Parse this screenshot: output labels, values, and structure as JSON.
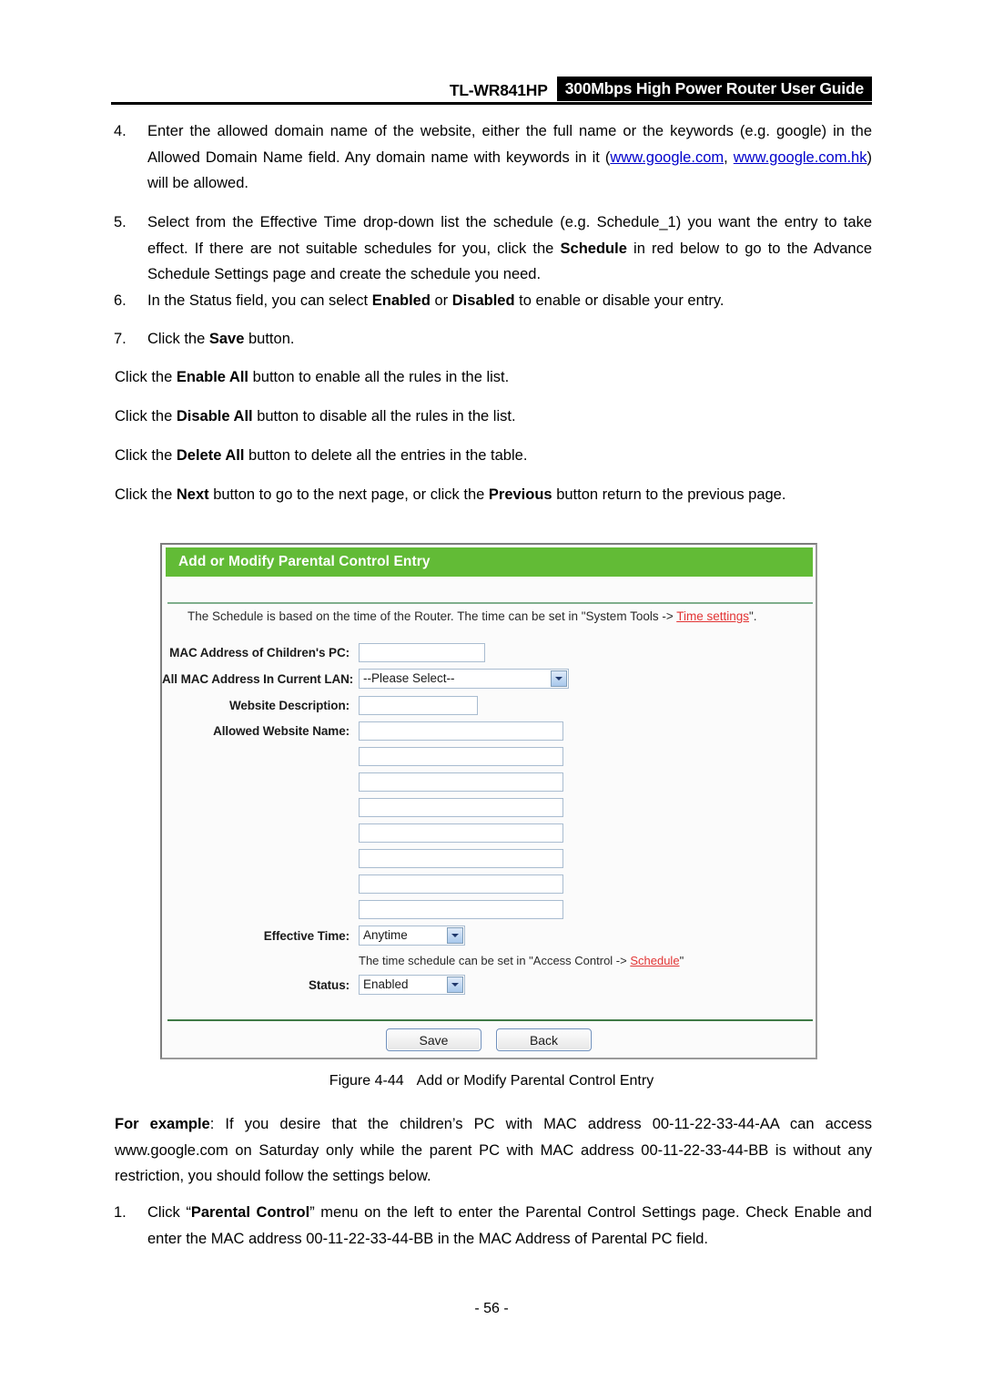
{
  "header": {
    "model": "TL-WR841HP",
    "title": "300Mbps High Power Router User Guide"
  },
  "steps": [
    {
      "num": "4.",
      "text_before": "Enter the allowed domain name of the website, either the full name or the keywords (e.g. google) in the Allowed Domain Name field. Any domain name with keywords in it (",
      "link1": "www.google.com",
      "mid": ", ",
      "link2": "www.google.com.hk",
      "text_after": ") will be allowed."
    },
    {
      "num": "5.",
      "part1": "Select from the Effective Time drop-down list the schedule (e.g. Schedule_1) you want the entry to take effect. If there are not suitable schedules for you, click the ",
      "bold1": "Schedule",
      "part2": " in red below to go to the Advance Schedule Settings page and create the schedule you need."
    },
    {
      "num": "6.",
      "part1": "In the Status field, you can select ",
      "bold1": "Enabled",
      "part2": " or ",
      "bold2": "Disabled",
      "part3": " to enable or disable your entry."
    },
    {
      "num": "7.",
      "part1": "Click the ",
      "bold1": "Save",
      "part2": " button."
    }
  ],
  "paragraphs": [
    {
      "part1": "Click the ",
      "bold1": "Enable All",
      "part2": " button to enable all the rules in the list."
    },
    {
      "part1": "Click the ",
      "bold1": "Disable All",
      "part2": " button to disable all the rules in the list."
    },
    {
      "part1": "Click the ",
      "bold1": "Delete All",
      "part2": " button to delete all the entries in the table."
    },
    {
      "part1": "Click the ",
      "bold1": "Next",
      "part2": " button to go to the next page, or click the ",
      "bold2": "Previous",
      "part3": " button return to the previous page."
    }
  ],
  "panel": {
    "title": "Add or Modify Parental Control Entry",
    "note_before": "The Schedule is based on the time of the Router. The time can be set in \"System Tools -> ",
    "note_link": "Time settings",
    "note_after": "\".",
    "fields": {
      "mac_label": "MAC Address of Children's PC:",
      "mac_value": "",
      "lan_label": "All MAC Address In Current LAN:",
      "lan_value": "--Please Select--",
      "desc_label": "Website Description:",
      "desc_value": "",
      "website_label": "Allowed Website Name:",
      "website_values": [
        "",
        "",
        "",
        "",
        "",
        "",
        "",
        ""
      ],
      "time_label": "Effective Time:",
      "time_value": "Anytime",
      "time_note_before": "The time schedule can be set in \"Access Control -> ",
      "time_note_link": "Schedule",
      "time_note_after": "\"",
      "status_label": "Status:",
      "status_value": "Enabled"
    },
    "buttons": {
      "save": "Save",
      "back": "Back"
    },
    "colors": {
      "header_green": "#62bb36",
      "link_red": "#e23434",
      "rule_green": "#3f7a46"
    }
  },
  "figure": {
    "number": "Figure 4-44",
    "caption": "Add or Modify Parental Control Entry"
  },
  "example": {
    "label": "For example",
    "text": ": If you desire that the children’s PC with MAC address 00-11-22-33-44-AA can access www.google.com on Saturday only while the parent PC with MAC address 00-11-22-33-44-BB is without any restriction, you should follow the settings below."
  },
  "final_step": {
    "num": "1.",
    "part1": "Click “",
    "bold1": "Parental Control",
    "part2": "” menu on the left to enter the Parental Control Settings page. Check Enable and enter the MAC address 00-11-22-33-44-BB in the MAC Address of Parental PC field."
  },
  "footer": {
    "page": "- 56 -"
  }
}
